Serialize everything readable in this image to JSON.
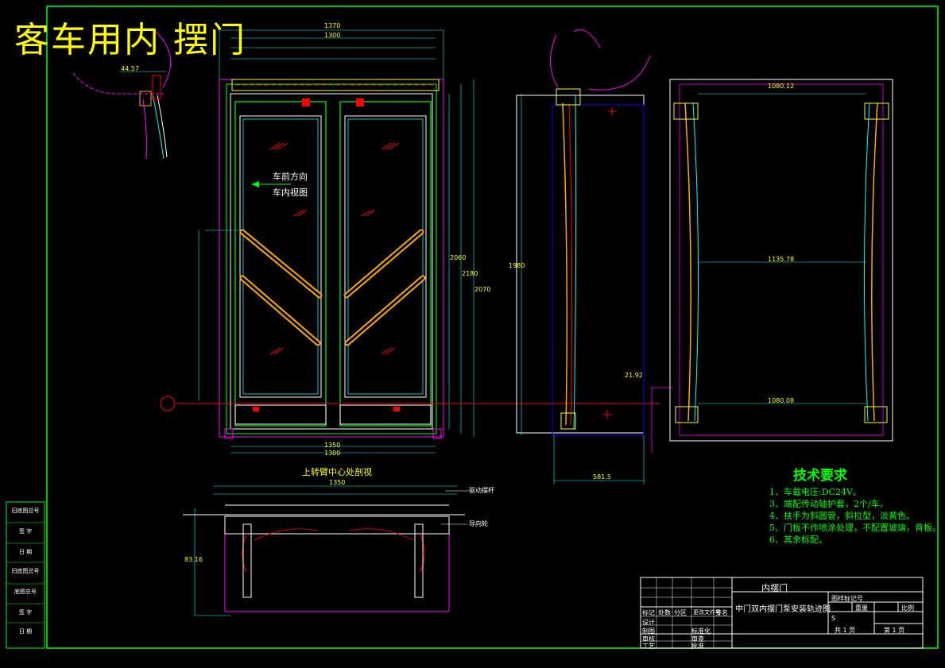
{
  "title": "客车用内 摆门",
  "view_labels": {
    "direction_line1": "车前方向",
    "direction_line2": "车内视图",
    "section_title": "上转臂中心处剖视"
  },
  "tech_requirements": {
    "heading": "技术要求",
    "items": [
      "1、车载电压:DC24V。",
      "3、端配传动轴护套，2个/车。",
      "4、扶手为斜圆管，斜拉型，淡黄色。",
      "5、门板不作喷涂处理，不配置玻璃，背板。",
      "6、其余标配。"
    ]
  },
  "dimensions": {
    "front_top_1": "1370",
    "front_top_2": "1300",
    "front_bottom_1": "1350",
    "front_bottom_2": "1300",
    "front_height_1": "2060",
    "front_height_2": "2180",
    "front_height_3": "2070",
    "side_top": "44.57",
    "side_height": "1980",
    "side_bottom": "581.5",
    "side_right": "21.92",
    "rear_top": "1080.12",
    "rear_mid": "1135.78",
    "rear_bottom": "1080.08",
    "section_top": "1350",
    "section_side": "83.16"
  },
  "callouts": {
    "right_1": "驱动摆杆",
    "right_2": "导向轮"
  },
  "left_stamps": [
    "旧底图总号",
    "签 字",
    "日 期",
    "旧底图总号",
    "底图总号",
    "签 字",
    "日 期"
  ],
  "title_block": {
    "part_name": "内摆门",
    "drawing_name": "中门双内摆门泵安装轨迹图",
    "code_label": "图样标记号",
    "scale_label": "比例",
    "weight_label": "重量",
    "sheet_total": "共 1 页",
    "sheet_num": "第 1 页",
    "mark": "S",
    "rows_left": [
      "标记",
      "设计",
      "制图",
      "审核",
      "工艺"
    ],
    "rows_mid": [
      "处数",
      "分区",
      "更改文件号",
      "签名",
      "日期"
    ],
    "rows_right": [
      "标准化",
      "审查",
      "批准"
    ]
  },
  "colors": {
    "frame": "#00ff00",
    "outline": "#ffffff",
    "dim": "#00ffff",
    "hidden": "#ff00ff",
    "center": "#ff0000",
    "glass": "#ffff00",
    "handrail": "#ffaa00"
  }
}
